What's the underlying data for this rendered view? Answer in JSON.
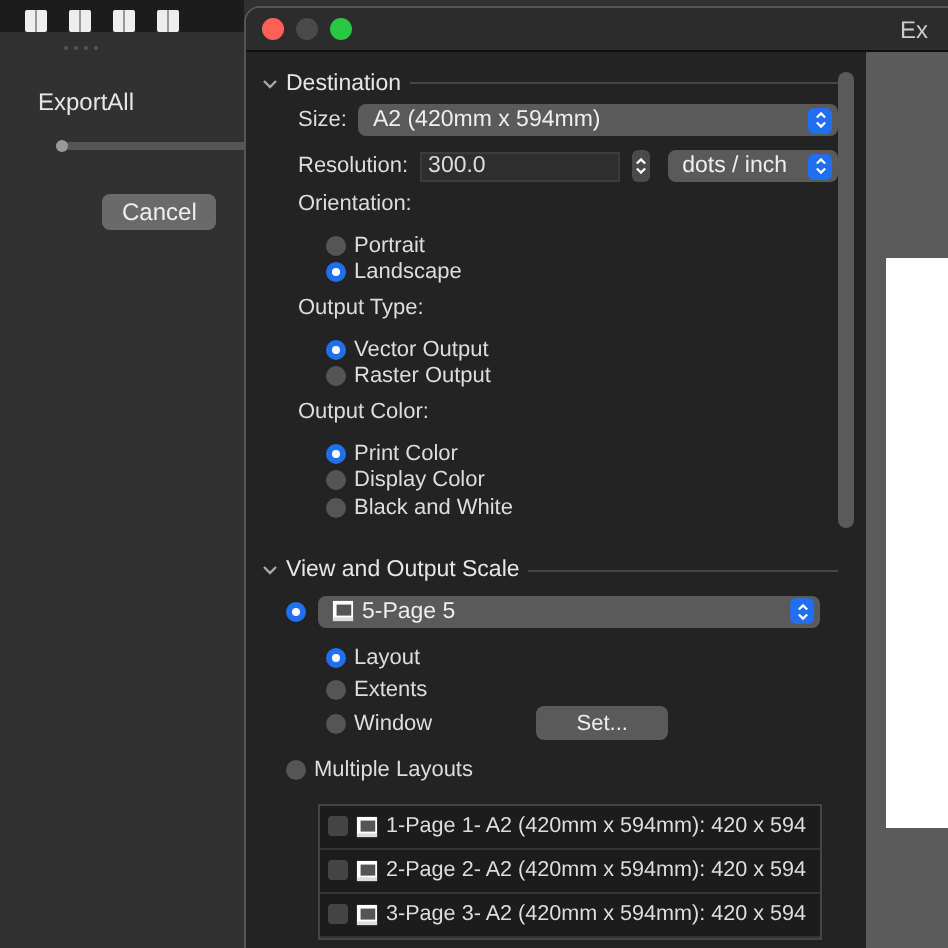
{
  "left_panel": {
    "title": "ExportAll",
    "progress": {
      "level": 0.0
    },
    "cancel_button": "Cancel"
  },
  "dialog": {
    "title": "Ex",
    "destination": {
      "heading": "Destination",
      "expanded": true,
      "size_label": "Size:",
      "size_value": "A2 (420mm x 594mm)",
      "resolution_label": "Resolution:",
      "resolution_value": "300.0",
      "unit_value": "dots / inch",
      "groups": [
        {
          "label": "Orientation:",
          "options": [
            {
              "label": "Portrait",
              "selected": false
            },
            {
              "label": "Landscape",
              "selected": true
            }
          ]
        },
        {
          "label": "Output Type:",
          "options": [
            {
              "label": "Vector Output",
              "selected": true
            },
            {
              "label": "Raster Output",
              "selected": false
            }
          ]
        },
        {
          "label": "Output Color:",
          "options": [
            {
              "label": "Print Color",
              "selected": true
            },
            {
              "label": "Display Color",
              "selected": false
            },
            {
              "label": "Black and White",
              "selected": false
            }
          ]
        }
      ]
    },
    "view_scale": {
      "heading": "View and Output Scale",
      "expanded": true,
      "single": {
        "selected": true,
        "layout": "5-Page 5",
        "options": [
          {
            "label": "Layout",
            "selected": true
          },
          {
            "label": "Extents",
            "selected": false
          },
          {
            "label": "Window",
            "selected": false,
            "button": "Set..."
          }
        ]
      },
      "multiple": {
        "label": "Multiple Layouts",
        "selected": false,
        "layouts": [
          {
            "label": "1-Page 1- A2 (420mm x 594mm): 420 x 594",
            "checked": false
          },
          {
            "label": "2-Page 2- A2 (420mm x 594mm): 420 x 594",
            "checked": false
          },
          {
            "label": "3-Page 3- A2 (420mm x 594mm): 420 x 594",
            "checked": false
          }
        ]
      }
    }
  }
}
